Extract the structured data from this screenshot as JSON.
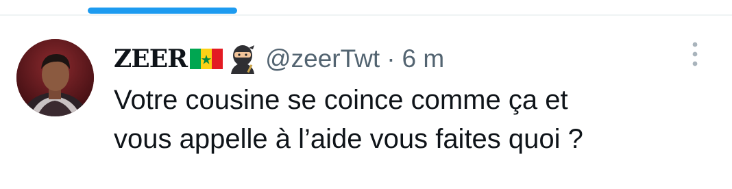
{
  "tweet": {
    "display_name": "ZEER",
    "handle": "@zeerTwt",
    "separator": "·",
    "time": "6 m",
    "text_lines": [
      "Votre cousine se coince comme ça et",
      "vous appelle à l’aide vous faites quoi ?"
    ],
    "emoji": [
      "senegal-flag-icon",
      "ninja-icon"
    ]
  },
  "icons": {
    "more": "more-vertical-icon",
    "avatar": "avatar"
  },
  "colors": {
    "accent": "#1d9bf0",
    "text": "#0f1419",
    "secondary": "#536471",
    "divider": "#eff3f4"
  }
}
